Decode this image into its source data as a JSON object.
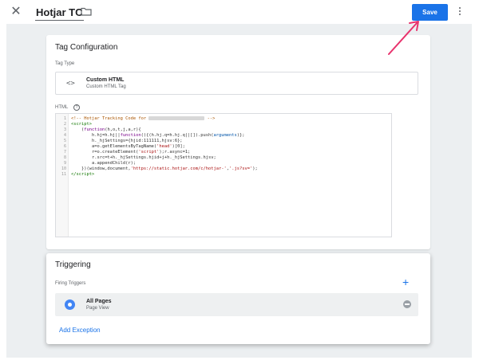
{
  "header": {
    "close_icon": "close-icon",
    "title": "Hotjar TC",
    "folder_icon": "folder-icon",
    "save_label": "Save",
    "more_icon": "more-vert-icon"
  },
  "config": {
    "card_title": "Tag Configuration",
    "tag_type_label": "Tag Type",
    "tag_type_name": "Custom HTML",
    "tag_type_desc": "Custom HTML Tag",
    "html_label": "HTML",
    "help_icon": "?",
    "code_icon": "<>",
    "line_numbers": [
      "1",
      "2",
      "3",
      "4",
      "5",
      "6",
      "7",
      "8",
      "9",
      "10",
      "11"
    ]
  },
  "triggering": {
    "card_title": "Triggering",
    "firing_label": "Firing Triggers",
    "add_icon": "+",
    "trigger_name": "All Pages",
    "trigger_type": "Page View",
    "add_exception": "Add Exception"
  },
  "colors": {
    "accent": "#1a73e8",
    "annotation_arrow": "#e8336d"
  }
}
